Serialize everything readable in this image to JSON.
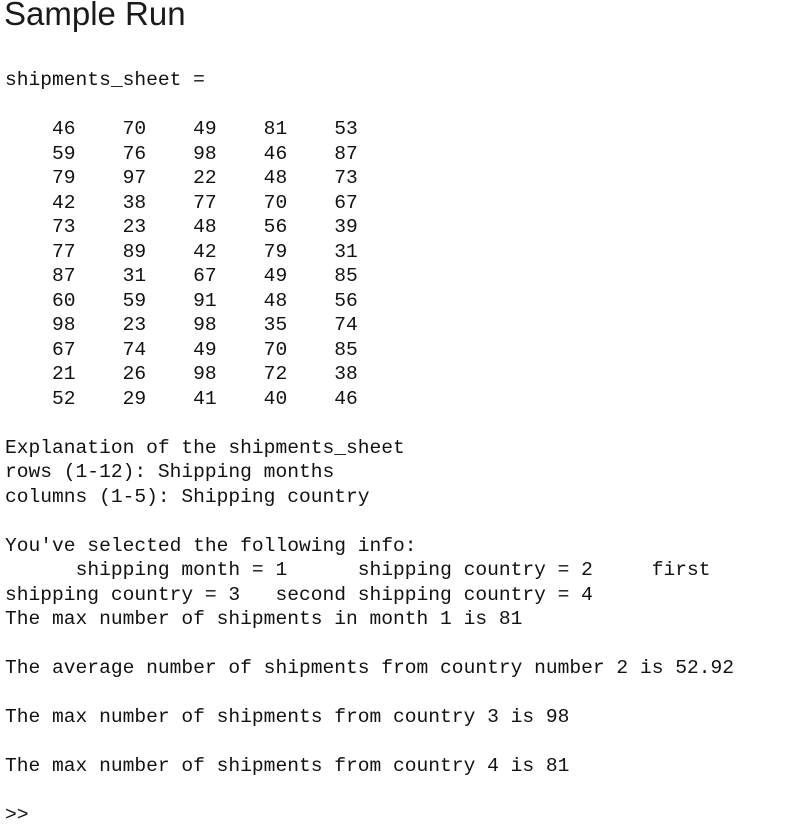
{
  "heading": "Sample Run",
  "console": {
    "variable_echo": "shipments_sheet =",
    "matrix": {
      "name": "shipments_sheet",
      "rows": 12,
      "columns": 5,
      "values": [
        [
          46,
          70,
          49,
          81,
          53
        ],
        [
          59,
          76,
          98,
          46,
          87
        ],
        [
          79,
          97,
          22,
          48,
          73
        ],
        [
          42,
          38,
          77,
          70,
          67
        ],
        [
          73,
          23,
          48,
          56,
          39
        ],
        [
          77,
          89,
          42,
          79,
          31
        ],
        [
          87,
          31,
          67,
          49,
          85
        ],
        [
          60,
          59,
          91,
          48,
          56
        ],
        [
          98,
          23,
          98,
          35,
          74
        ],
        [
          67,
          74,
          49,
          70,
          85
        ],
        [
          21,
          26,
          98,
          72,
          38
        ],
        [
          52,
          29,
          41,
          40,
          46
        ]
      ]
    },
    "explanation": {
      "header": "Explanation of the shipments_sheet",
      "rows_desc": "rows (1-12): Shipping months",
      "columns_desc": "columns (1-5): Shipping country"
    },
    "selection": {
      "header": "You've selected the following info:",
      "body": "      shipping month = 1      shipping country = 2     first shipping country = 3   second shipping country = 4"
    },
    "results": [
      "The max number of shipments in month 1 is 81",
      "The average number of shipments from country number 2 is 52.92",
      "The max number of shipments from country 3 is 98",
      "The max number of shipments from country 4 is 81"
    ],
    "prompt": ">>"
  },
  "matrix_lines": [
    "    46    70    49    81    53",
    "    59    76    98    46    87",
    "    79    97    22    48    73",
    "    42    38    77    70    67",
    "    73    23    48    56    39",
    "    77    89    42    79    31",
    "    87    31    67    49    85",
    "    60    59    91    48    56",
    "    98    23    98    35    74",
    "    67    74    49    70    85",
    "    21    26    98    72    38",
    "    52    29    41    40    46"
  ]
}
